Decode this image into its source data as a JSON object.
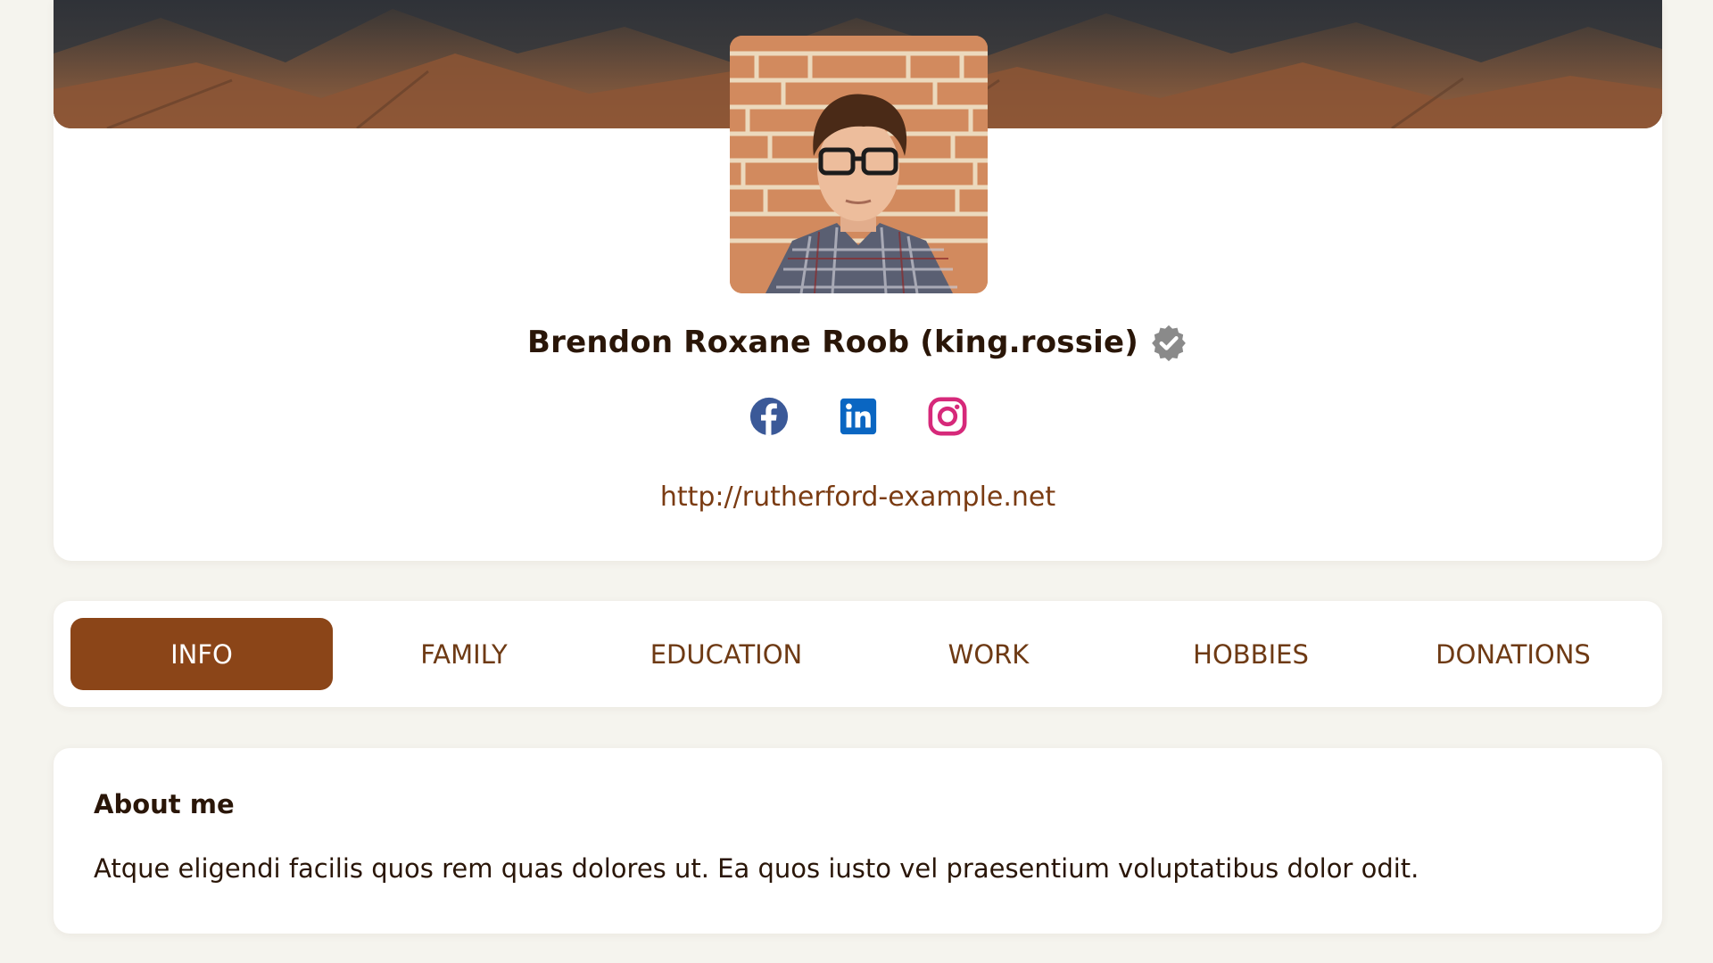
{
  "profile": {
    "full_name": "Brendon Roxane Roob",
    "username": "king.rossie",
    "display_name": "Brendon Roxane Roob (king.rossie)",
    "verified": true,
    "website": "http://rutherford-example.net",
    "cover_image_alt": "Mountain landscape cover photo",
    "avatar_alt": "Young man with glasses in plaid shirt against brick wall"
  },
  "social": [
    {
      "name": "facebook",
      "icon": "facebook-icon",
      "color": "#3b5998"
    },
    {
      "name": "linkedin",
      "icon": "linkedin-icon",
      "color": "#0a66c2"
    },
    {
      "name": "instagram",
      "icon": "instagram-icon",
      "color": "#d6297a"
    }
  ],
  "tabs": [
    {
      "label": "INFO",
      "active": true
    },
    {
      "label": "FAMILY",
      "active": false
    },
    {
      "label": "EDUCATION",
      "active": false
    },
    {
      "label": "WORK",
      "active": false
    },
    {
      "label": "HOBBIES",
      "active": false
    },
    {
      "label": "DONATIONS",
      "active": false
    }
  ],
  "about": {
    "title": "About me",
    "text": "Atque eligendi facilis quos rem quas dolores ut. Ea quos iusto vel praesentium voluptatibus dolor odit."
  },
  "colors": {
    "page_background": "#f5f4ee",
    "accent": "#8b4518",
    "link": "#7a3b12",
    "text": "#2a1608",
    "verified_badge": "#8a8a8a"
  }
}
